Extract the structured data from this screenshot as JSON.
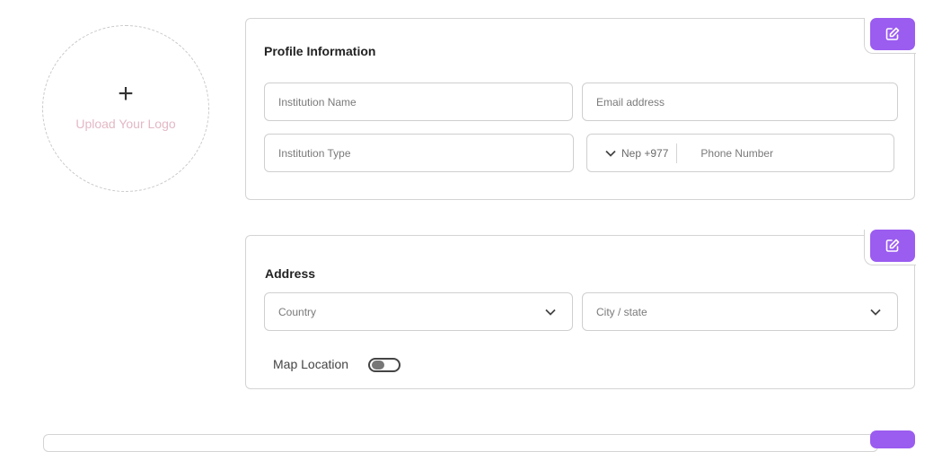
{
  "logo": {
    "plus": "+",
    "label": "Upload Your Logo"
  },
  "profile": {
    "title": "Profile Information",
    "institution_name_placeholder": "Institution Name",
    "email_placeholder": "Email address",
    "institution_type_placeholder": "Institution Type",
    "phone_code": "Nep +977",
    "phone_placeholder": "Phone Number"
  },
  "address": {
    "title": "Address",
    "country_placeholder": "Country",
    "city_placeholder": "City / state",
    "map_location_label": "Map Location",
    "map_location_enabled": false
  },
  "colors": {
    "accent": "#9b5cf0",
    "upload_label": "#e3b8c5",
    "border": "#d4d4d4"
  },
  "icons": {
    "edit": "edit-icon",
    "chevron": "chevron-down-icon",
    "plus": "plus-icon"
  }
}
